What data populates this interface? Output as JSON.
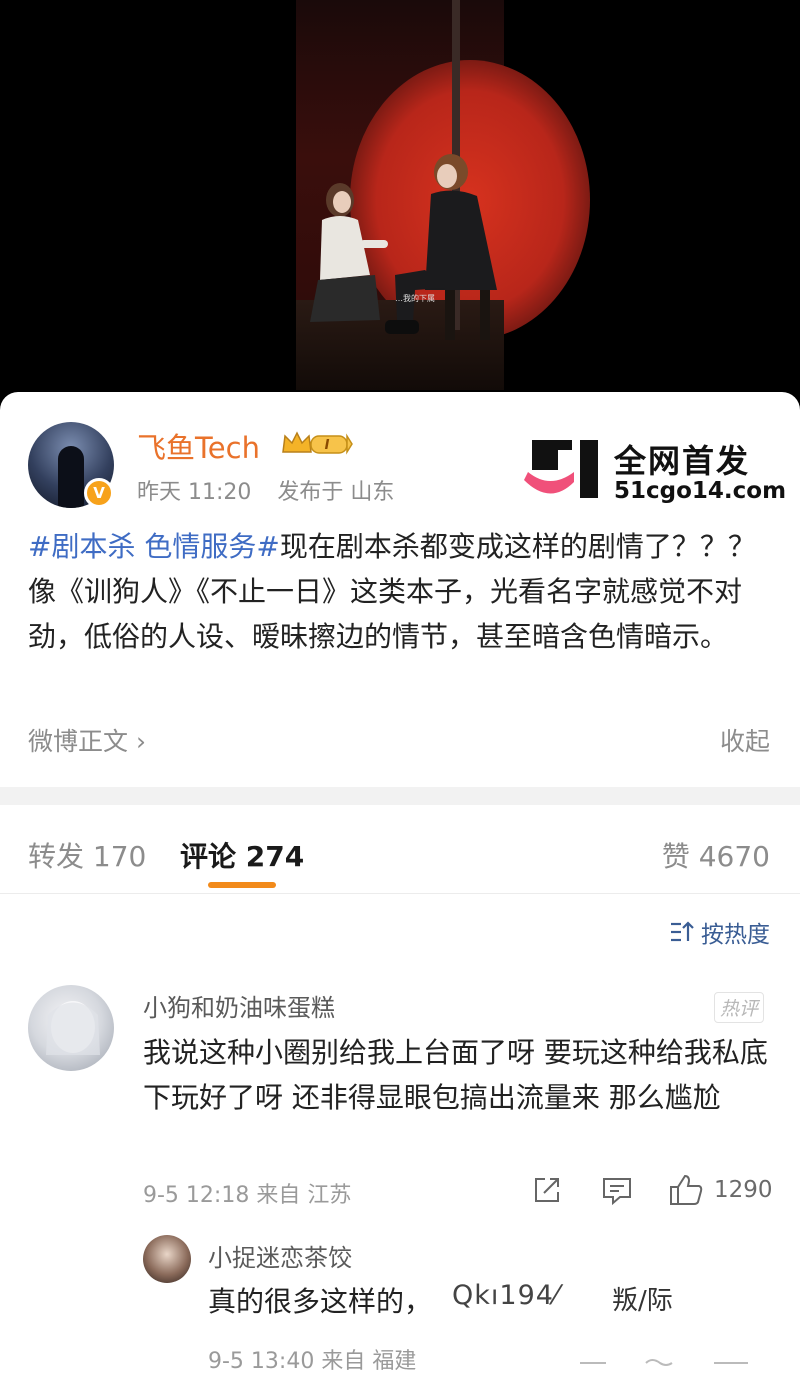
{
  "video": {
    "subtitle_snippet": "…我的下属"
  },
  "post": {
    "username": "飞鱼Tech",
    "member_badge": "I",
    "verified_badge": "V",
    "time": "昨天 11:20",
    "location": "发布于 山东",
    "hashtag": "#剧本杀 色情服务#",
    "body": "现在剧本杀都变成这样的剧情了？？？ 像《训狗人》《不止一日》这类本子，光看名字就感觉不对劲，低俗的人设、暧昧擦边的情节，甚至暗含色情暗示。",
    "original_link": "微博正文 ›",
    "collapse": "收起"
  },
  "watermark": {
    "title": "全网首发",
    "url": "51cgo14.com"
  },
  "tabs": {
    "repost": "转发 170",
    "comments": "评论 274",
    "likes": "赞 4670"
  },
  "sort": {
    "label": "按热度"
  },
  "comment": {
    "name": "小狗和奶油味蛋糕",
    "hot_badge": "热评",
    "text": "我说这种小圈别给我上台面了呀 要玩这种给我私底下玩好了呀 还非得显眼包搞出流量来 那么尴尬",
    "meta": "9-5 12:18 来自 江苏",
    "like_count": "1290"
  },
  "reply": {
    "name": "小捉迷恋茶饺",
    "text": "真的很多这样的，",
    "overlay_text": "Qkı194⁄",
    "overlay_text2": "叛/际",
    "meta": "9-5 13:40 来自 福建"
  },
  "colors": {
    "accent": "#f28a1a",
    "username": "#e9722b",
    "hashtag": "#3f6cc4",
    "sort": "#3a5d94"
  }
}
